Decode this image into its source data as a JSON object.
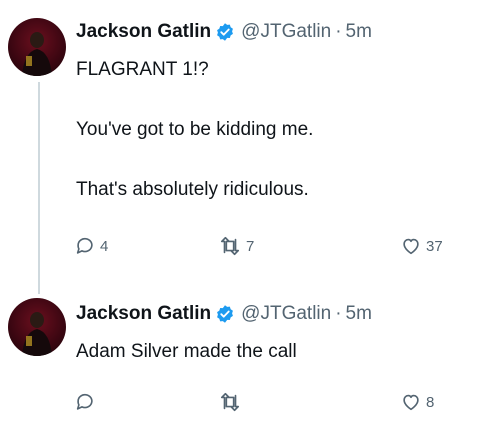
{
  "tweets": [
    {
      "author": {
        "name": "Jackson Gatlin",
        "handle": "@JTGatlin",
        "separator": "·",
        "time": "5m",
        "verified": true
      },
      "text_lines": [
        "FLAGRANT 1!?",
        "You've got to be kidding me.",
        "That's absolutely ridiculous."
      ],
      "actions": {
        "reply_count": "4",
        "retweet_count": "7",
        "like_count": "37"
      }
    },
    {
      "author": {
        "name": "Jackson Gatlin",
        "handle": "@JTGatlin",
        "separator": "·",
        "time": "5m",
        "verified": true
      },
      "text_lines": [
        "Adam Silver made the call"
      ],
      "actions": {
        "reply_count": "",
        "retweet_count": "",
        "like_count": "8"
      }
    }
  ],
  "icons": {
    "verified": "verified-badge-icon",
    "reply": "reply-icon",
    "retweet": "retweet-icon",
    "like": "heart-icon"
  },
  "colors": {
    "verified_blue": "#1d9bf0",
    "muted_text": "#536471",
    "text": "#0f1419",
    "thread_line": "#cfd9de"
  }
}
